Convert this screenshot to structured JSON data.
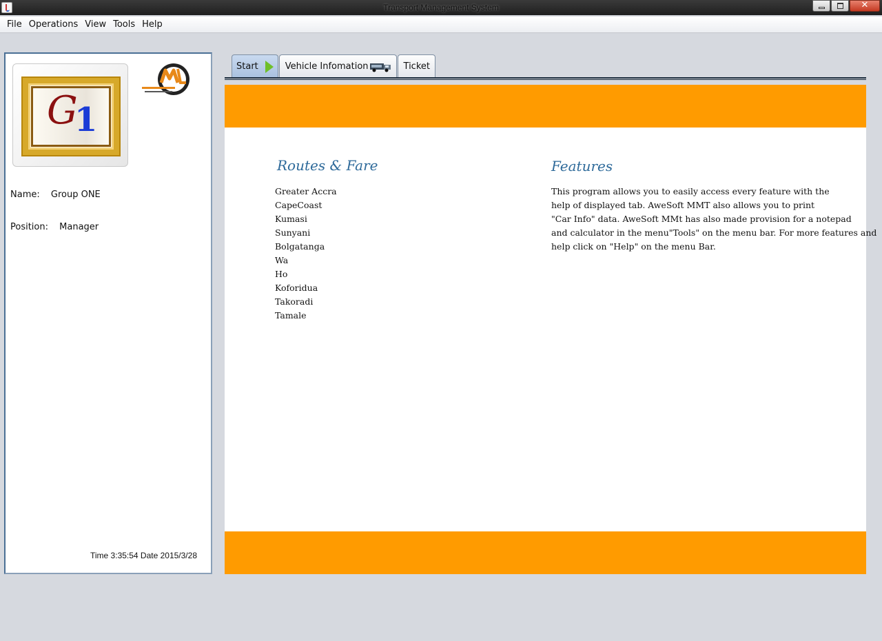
{
  "window": {
    "title": "Transport Management System"
  },
  "menu": [
    "File",
    "Operations",
    "View",
    "Tools",
    "Help"
  ],
  "profile": {
    "name_label": "Name:",
    "name_value": "Group ONE",
    "position_label": "Position:",
    "position_value": "Manager",
    "clock": "Time 3:35:54 Date 2015/3/28",
    "logo_text": "G1"
  },
  "tabs": [
    {
      "label": "Start",
      "icon": "play-icon",
      "active": true
    },
    {
      "label": "Vehicle Infomation",
      "icon": "truck-icon",
      "active": false
    },
    {
      "label": "Ticket",
      "icon": "",
      "active": false
    }
  ],
  "routes": {
    "title": "Routes & Fare",
    "items": [
      "Greater Accra",
      "CapeCoast",
      "Kumasi",
      "Sunyani",
      "Bolgatanga",
      "Wa",
      "Ho",
      "Koforidua",
      "Takoradi",
      "Tamale"
    ]
  },
  "features": {
    "title": "Features",
    "lines": [
      "This program allows you to easily access every feature with the",
      "help of displayed tab. AweSoft MMT also allows you to print",
      "\"Car Info\" data. AweSoft MMt has also made provision for a notepad",
      "and calculator in the menu\"Tools\" on the menu bar. For more features and",
      "help click on \"Help\" on the menu Bar."
    ]
  },
  "colors": {
    "banner": "#ff9b00",
    "heading": "#2e6a9a",
    "panel_border": "#4a6f95"
  }
}
